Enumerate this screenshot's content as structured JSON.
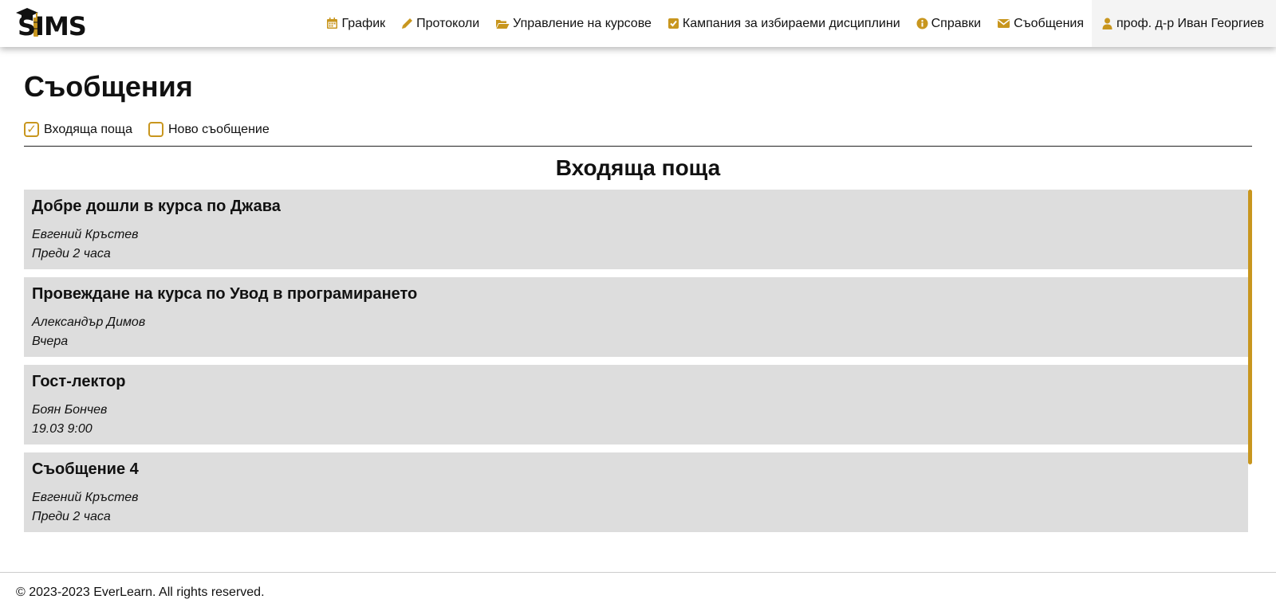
{
  "brand": {
    "logo_text": "SIMS"
  },
  "nav": {
    "items": [
      {
        "label": "График",
        "icon": "calendar-icon"
      },
      {
        "label": "Протоколи",
        "icon": "pencil-icon"
      },
      {
        "label": "Управление на курсове",
        "icon": "folder-open-icon"
      },
      {
        "label": "Кампания за избираеми дисциплини",
        "icon": "checkbox-icon"
      },
      {
        "label": "Справки",
        "icon": "info-icon"
      },
      {
        "label": "Съобщения",
        "icon": "envelope-icon"
      }
    ],
    "profile": {
      "label": "проф. д-р Иван Георгиев",
      "icon": "user-icon"
    }
  },
  "page": {
    "title": "Съобщения",
    "tabs": [
      {
        "label": "Входяща поща",
        "checked": true
      },
      {
        "label": "Ново съобщение",
        "checked": false
      }
    ],
    "section_title": "Входяща поща"
  },
  "messages": [
    {
      "title": "Добре дошли в курса по Джава",
      "sender": "Евгений Кръстев",
      "time": "Преди 2 часа"
    },
    {
      "title": "Провеждане на курса по Увод в програмирането",
      "sender": "Александър Димов",
      "time": "Вчера"
    },
    {
      "title": "Гост-лектор",
      "sender": "Боян Бончев",
      "time": "19.03 9:00"
    },
    {
      "title": "Съобщение 4",
      "sender": "Евгений Кръстев",
      "time": "Преди 2 часа"
    }
  ],
  "footer": {
    "text": "© 2023-2023 EverLearn. All rights reserved."
  },
  "colors": {
    "accent": "#c8961e",
    "card_bg": "#dddddd"
  }
}
